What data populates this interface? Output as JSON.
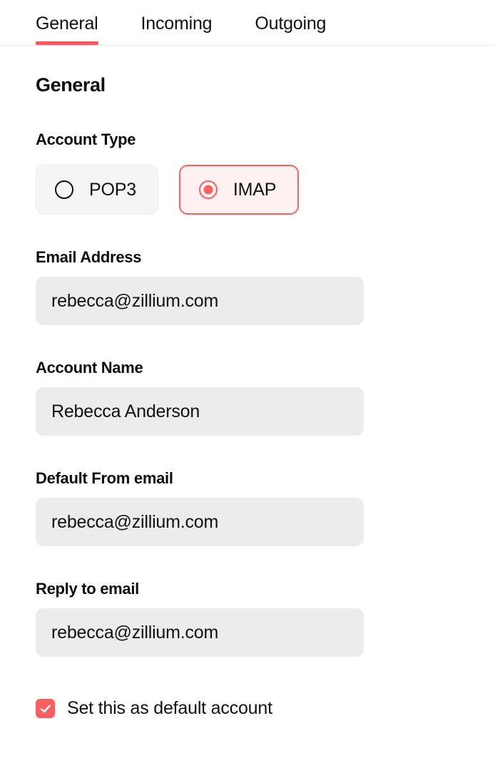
{
  "tabs": [
    {
      "label": "General",
      "active": true
    },
    {
      "label": "Incoming",
      "active": false
    },
    {
      "label": "Outgoing",
      "active": false
    }
  ],
  "section": {
    "title": "General"
  },
  "account_type": {
    "label": "Account Type",
    "options": [
      {
        "label": "POP3",
        "selected": false
      },
      {
        "label": "IMAP",
        "selected": true
      }
    ]
  },
  "fields": [
    {
      "label": "Email Address",
      "value": "rebecca@zillium.com",
      "placeholder": "Email Address"
    },
    {
      "label": "Account Name",
      "value": "Rebecca Anderson",
      "placeholder": "Account Name"
    },
    {
      "label": "Default From email",
      "value": "rebecca@zillium.com",
      "placeholder": "Default From email"
    },
    {
      "label": "Reply to email",
      "value": "rebecca@zillium.com",
      "placeholder": "Reply to email"
    }
  ],
  "default_account": {
    "label": "Set this as default account",
    "checked": true
  },
  "colors": {
    "accent": "#fb5a5a",
    "accent_border": "#fb6161",
    "accent_bg": "#fef1f1",
    "input_bg": "#ececec",
    "card_bg": "#f5f5f5",
    "text": "#111111",
    "divider": "#e8e8e8"
  }
}
